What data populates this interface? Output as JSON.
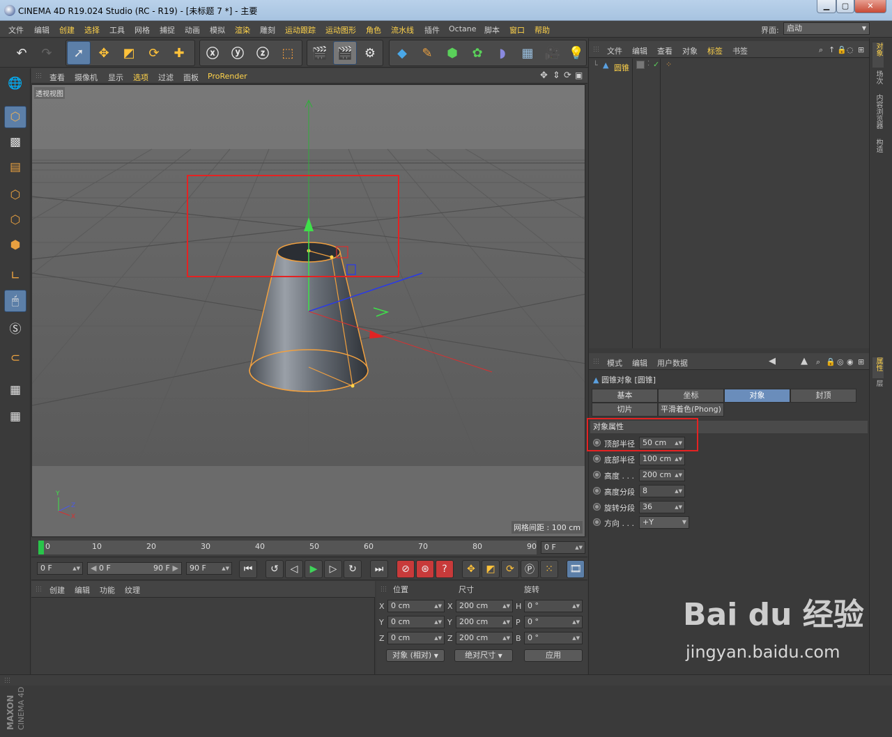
{
  "window": {
    "title": "CINEMA 4D R19.024 Studio (RC - R19) - [未标题 7 *] - 主要"
  },
  "menu": [
    "文件",
    "编辑",
    "创建",
    "选择",
    "工具",
    "网格",
    "捕捉",
    "动画",
    "模拟",
    "渲染",
    "雕刻",
    "运动跟踪",
    "运动图形",
    "角色",
    "流水线",
    "插件",
    "Octane",
    "脚本",
    "窗口",
    "帮助"
  ],
  "layout": {
    "label": "界面:",
    "value": "启动"
  },
  "viewport": {
    "menu": [
      "查看",
      "摄像机",
      "显示",
      "选项",
      "过滤",
      "面板",
      "ProRender"
    ],
    "label": "透视视图",
    "grid_spacing": "网格间距 : 100 cm",
    "axis_x": "X",
    "axis_y": "Y",
    "axis_z": "Z"
  },
  "timeline": {
    "ticks": [
      "0",
      "10",
      "20",
      "30",
      "40",
      "50",
      "60",
      "70",
      "80",
      "90"
    ],
    "current_frame": "0 F"
  },
  "playback": {
    "start": "0 F",
    "range_start": "0 F",
    "range_end": "90 F",
    "end": "90 F"
  },
  "materials": {
    "menu": [
      "创建",
      "编辑",
      "功能",
      "纹理"
    ]
  },
  "coordinates": {
    "headers": [
      "位置",
      "尺寸",
      "旋转"
    ],
    "position": {
      "x": "0 cm",
      "y": "0 cm",
      "z": "0 cm"
    },
    "size": {
      "x": "200 cm",
      "y": "200 cm",
      "z": "200 cm"
    },
    "rotation": {
      "h": "0 °",
      "p": "0 °",
      "b": "0 °"
    },
    "axis_labels": {
      "x": "X",
      "y": "Y",
      "z": "Z",
      "h": "H",
      "p": "P",
      "b": "B"
    },
    "mode": "对象 (相对)",
    "size_mode": "绝对尺寸",
    "apply": "应用"
  },
  "object_manager": {
    "menu": [
      "文件",
      "编辑",
      "查看",
      "对象",
      "标签",
      "书签"
    ],
    "objects": [
      {
        "name": "圆锥"
      }
    ]
  },
  "attributes": {
    "menu": [
      "模式",
      "编辑",
      "用户数据"
    ],
    "title": "圆锥对象 [圆锥]",
    "tabs_row1": [
      "基本",
      "坐标",
      "对象",
      "封顶"
    ],
    "tabs_row2": [
      "切片",
      "平滑着色(Phong)"
    ],
    "active_tab": "对象",
    "section": "对象属性",
    "props": [
      {
        "label": "顶部半径",
        "value": "50 cm"
      },
      {
        "label": "底部半径",
        "value": "100 cm"
      },
      {
        "label": "高度 . . .",
        "value": "200 cm"
      },
      {
        "label": "高度分段",
        "value": "8"
      },
      {
        "label": "旋转分段",
        "value": "36"
      },
      {
        "label": "方向 . . .",
        "value": "+Y"
      }
    ]
  },
  "side_tabs": [
    "对象",
    "场次",
    "内容浏览器",
    "构造"
  ],
  "side_tabs_lower": [
    "属性",
    "层"
  ],
  "brand_vertical": {
    "maxon": "MAXON",
    "c4d": "CINEMA 4D"
  },
  "watermark": {
    "brand": "Bai du 经验",
    "url": "jingyan.baidu.com"
  },
  "colors": {
    "accent": "#ffd34a",
    "selected": "#5c7fa8",
    "highlight_box": "#e52222"
  }
}
